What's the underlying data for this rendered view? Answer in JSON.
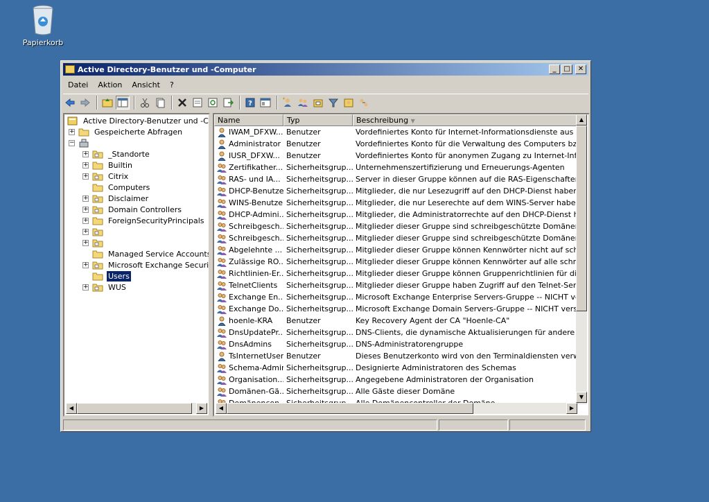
{
  "desktop": {
    "recycle_bin_label": "Papierkorb"
  },
  "window": {
    "title": "Active Directory-Benutzer und -Computer",
    "controls": {
      "minimize": "_",
      "maximize": "□",
      "close": "✕"
    }
  },
  "menu": [
    "Datei",
    "Aktion",
    "Ansicht",
    "?"
  ],
  "toolbar_icons": [
    "back-icon",
    "forward-icon",
    "up-folder-icon",
    "show-tree-icon",
    "cut-icon",
    "copy-icon",
    "delete-icon",
    "properties-icon",
    "refresh-icon",
    "export-icon",
    "help-icon",
    "console-icon",
    "new-user-icon",
    "new-group-icon",
    "new-ou-icon",
    "filter-icon",
    "add-to-group-icon",
    "delegate-icon"
  ],
  "tree": {
    "root": "Active Directory-Benutzer und -Computer",
    "saved_queries": "Gespeicherte Abfragen",
    "domain": "",
    "children": [
      "_Standorte",
      "Builtin",
      "Citrix",
      "Computers",
      "Disclaimer",
      "Domain Controllers",
      "ForeignSecurityPrincipals",
      "",
      "",
      "Managed Service Accounts",
      "Microsoft Exchange Security G",
      "Users",
      "WUS"
    ],
    "selected": "Users"
  },
  "list": {
    "columns": [
      "Name",
      "Typ",
      "Beschreibung"
    ],
    "rows": [
      {
        "name": "IWAM_DFXW...",
        "type": "Benutzer",
        "desc": "Vordefiniertes Konto für Internet-Informationsdienste aus Prozessa",
        "icon": "user"
      },
      {
        "name": "Administrator",
        "type": "Benutzer",
        "desc": "Vordefiniertes Konto für die Verwaltung des Computers bzw. der D",
        "icon": "user"
      },
      {
        "name": "IUSR_DFXW...",
        "type": "Benutzer",
        "desc": "Vordefiniertes Konto für anonymen Zugang zu Internet-Information",
        "icon": "user"
      },
      {
        "name": "Zertifikather...",
        "type": "Sicherheitsgrup...",
        "desc": "Unternehmenszertifizierung und Erneuerungs-Agenten",
        "icon": "group"
      },
      {
        "name": "RAS- und IA...",
        "type": "Sicherheitsgrup...",
        "desc": "Server in dieser Gruppe können auf die RAS-Eigenschaften von Be",
        "icon": "group"
      },
      {
        "name": "DHCP-Benutzer",
        "type": "Sicherheitsgrup...",
        "desc": "Mitglieder, die nur Lesezugriff auf den DHCP-Dienst haben",
        "icon": "group"
      },
      {
        "name": "WINS-Benutzer",
        "type": "Sicherheitsgrup...",
        "desc": "Mitglieder, die nur Leserechte auf dem WINS-Server haben",
        "icon": "group"
      },
      {
        "name": "DHCP-Admini...",
        "type": "Sicherheitsgrup...",
        "desc": "Mitglieder, die Administratorrechte auf den DHCP-Dienst haben",
        "icon": "group"
      },
      {
        "name": "Schreibgesch...",
        "type": "Sicherheitsgrup...",
        "desc": "Mitglieder dieser Gruppe sind schreibgeschützte Domänencontroller",
        "icon": "group"
      },
      {
        "name": "Schreibgesch...",
        "type": "Sicherheitsgrup...",
        "desc": "Mitglieder dieser Gruppe sind schreibgeschützte Domänencontroller",
        "icon": "group"
      },
      {
        "name": "Abgelehnte ...",
        "type": "Sicherheitsgrup...",
        "desc": "Mitglieder dieser Gruppe können Kennwörter nicht auf schreibgesch",
        "icon": "group"
      },
      {
        "name": "Zulässige RO...",
        "type": "Sicherheitsgrup...",
        "desc": "Mitglieder dieser Gruppe können Kennwörter auf alle schreibgeschü",
        "icon": "group"
      },
      {
        "name": "Richtlinien-Er...",
        "type": "Sicherheitsgrup...",
        "desc": "Mitglieder dieser Gruppe können Gruppenrichtlinien für die Domäne",
        "icon": "group"
      },
      {
        "name": "TelnetClients",
        "type": "Sicherheitsgrup...",
        "desc": "Mitglieder dieser Gruppe haben Zugriff auf den Telnet-Server auf d",
        "icon": "group"
      },
      {
        "name": "Exchange En...",
        "type": "Sicherheitsgrup...",
        "desc": "Microsoft Exchange Enterprise Servers-Gruppe -- NICHT verschieb",
        "icon": "group"
      },
      {
        "name": "Exchange Do...",
        "type": "Sicherheitsgrup...",
        "desc": "Microsoft Exchange Domain Servers-Gruppe -- NICHT verschieben",
        "icon": "group"
      },
      {
        "name": "hoenle-KRA",
        "type": "Benutzer",
        "desc": "Key Recovery Agent der CA \"Hoenle-CA\"",
        "icon": "user"
      },
      {
        "name": "DnsUpdatePr...",
        "type": "Sicherheitsgrup...",
        "desc": "DNS-Clients, die dynamische Aktualisierungen für andere Clients du",
        "icon": "group"
      },
      {
        "name": "DnsAdmins",
        "type": "Sicherheitsgrup...",
        "desc": "DNS-Administratorengruppe",
        "icon": "group"
      },
      {
        "name": "TsInternetUser",
        "type": "Benutzer",
        "desc": "Dieses Benutzerkonto wird von den Terminaldiensten verwendet.",
        "icon": "user"
      },
      {
        "name": "Schema-Admins",
        "type": "Sicherheitsgrup...",
        "desc": "Designierte Administratoren des Schemas",
        "icon": "group"
      },
      {
        "name": "Organisation...",
        "type": "Sicherheitsgrup...",
        "desc": "Angegebene Administratoren der Organisation",
        "icon": "group"
      },
      {
        "name": "Domänen-Gä...",
        "type": "Sicherheitsgrup...",
        "desc": "Alle Gäste dieser Domäne",
        "icon": "group"
      },
      {
        "name": "Domänencon...",
        "type": "Sicherheitsgrup...",
        "desc": "Alle Domänencontroller der Domäne",
        "icon": "group"
      }
    ]
  },
  "status": [
    "",
    "",
    ""
  ]
}
